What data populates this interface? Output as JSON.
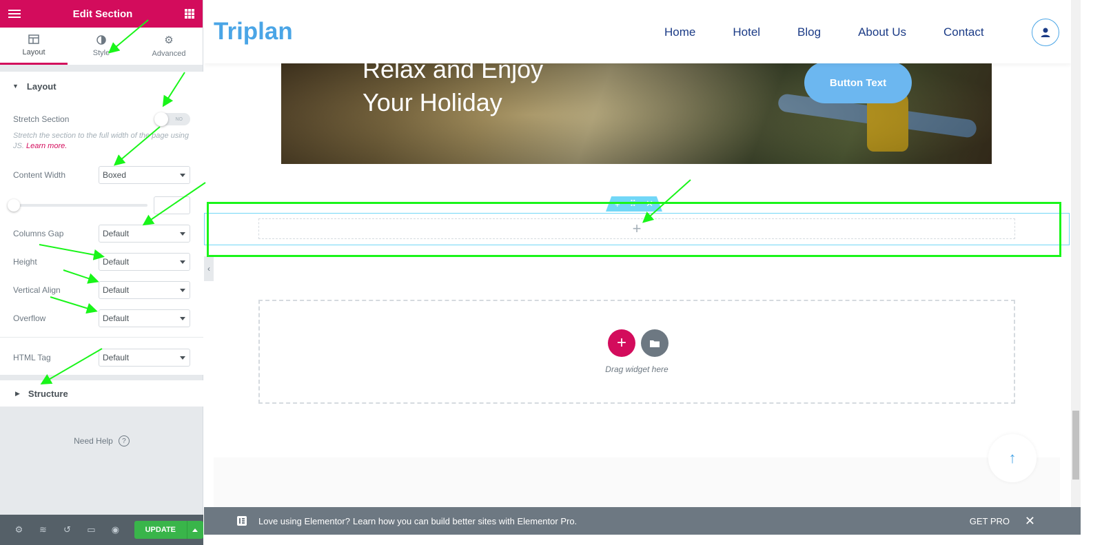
{
  "panel": {
    "title": "Edit Section",
    "tabs": [
      {
        "label": "Layout",
        "icon": "layout-icon"
      },
      {
        "label": "Style",
        "icon": "contrast-icon"
      },
      {
        "label": "Advanced",
        "icon": "gear-icon"
      }
    ],
    "layout_section": {
      "title": "Layout",
      "stretch_label": "Stretch Section",
      "stretch_value": "NO",
      "stretch_help": "Stretch the section to the full width of the page using JS.",
      "learn_more": "Learn more.",
      "content_width_label": "Content Width",
      "content_width_value": "Boxed",
      "columns_gap_label": "Columns Gap",
      "columns_gap_value": "Default",
      "height_label": "Height",
      "height_value": "Default",
      "vertical_align_label": "Vertical Align",
      "vertical_align_value": "Default",
      "overflow_label": "Overflow",
      "overflow_value": "Default",
      "html_tag_label": "HTML Tag",
      "html_tag_value": "Default"
    },
    "structure_section": {
      "title": "Structure"
    },
    "need_help": "Need Help",
    "footer": {
      "update_label": "UPDATE"
    }
  },
  "site": {
    "logo": "Triplan",
    "nav": [
      "Home",
      "Hotel",
      "Blog",
      "About Us",
      "Contact"
    ],
    "hero_title_line1": "Relax and Enjoy",
    "hero_title_line2": "Your Holiday",
    "hero_button": "Button Text",
    "drag_text": "Drag widget here"
  },
  "banner": {
    "text": "Love using Elementor?",
    "link": "Learn how you can build better sites with Elementor Pro.",
    "get_pro": "GET PRO"
  },
  "colors": {
    "brand": "#d30c5c",
    "update": "#39b54a",
    "logo": "#4aa5e6",
    "nav": "#1b3b86",
    "annotation": "#19f519"
  }
}
